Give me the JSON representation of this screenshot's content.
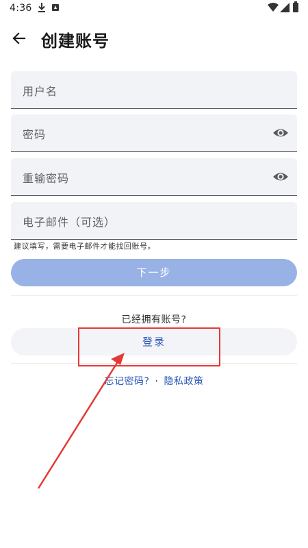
{
  "status_bar": {
    "time": "4:36",
    "icons": [
      "download-icon",
      "a-notification-icon",
      "wifi-icon",
      "signal-icon",
      "battery-icon"
    ]
  },
  "header": {
    "back_icon": "arrow-back-icon",
    "title": "创建账号"
  },
  "form": {
    "username_placeholder": "用户名",
    "password_placeholder": "密码",
    "confirm_password_placeholder": "重输密码",
    "email_placeholder": "电子邮件（可选）",
    "visibility_icon": "eye-icon",
    "email_hint": "建议填写，需要电子邮件才能找回账号。",
    "next_label": "下一步"
  },
  "login_section": {
    "prompt": "已经拥有账号?",
    "login_label": "登录"
  },
  "footer": {
    "forgot_password": "忘记密码?",
    "separator": "·",
    "privacy_policy": "隐私政策"
  },
  "colors": {
    "accent": "#2a56b8",
    "next_button_disabled": "#98b2e6",
    "field_background": "#f1f3f6",
    "annotation_red": "#e53935"
  }
}
